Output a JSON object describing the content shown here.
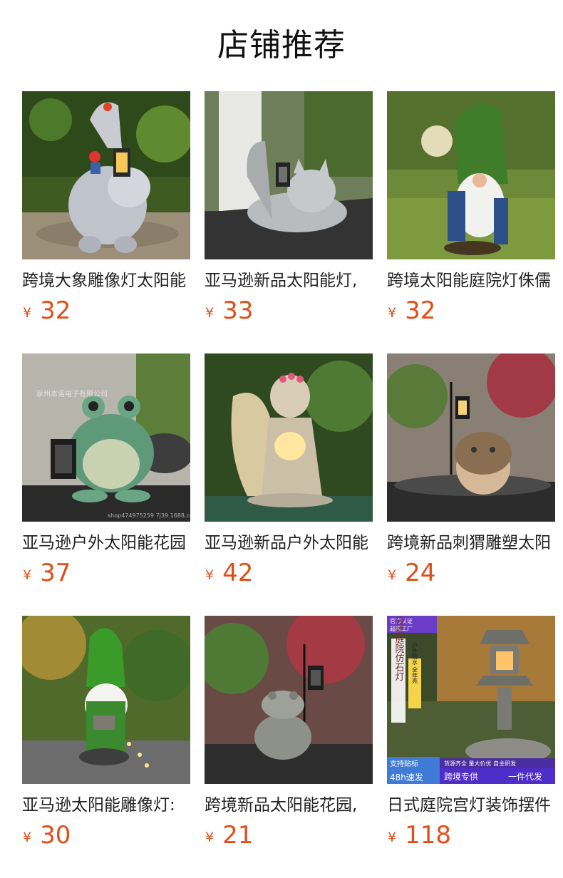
{
  "header": {
    "title": "店铺推荐"
  },
  "currency_symbol": "¥",
  "products": [
    {
      "name": "跨境大象雕像灯太阳能",
      "price": "32",
      "icon": "elephant-statue-lamp"
    },
    {
      "name": "亚马逊新品太阳能灯,",
      "price": "33",
      "icon": "cat-statue-lamp"
    },
    {
      "name": "跨境太阳能庭院灯侏儒",
      "price": "32",
      "icon": "gnome-statue-lamp"
    },
    {
      "name": "亚马逊户外太阳能花园",
      "price": "37",
      "icon": "frog-statue-lantern"
    },
    {
      "name": "亚马逊新品户外太阳能",
      "price": "42",
      "icon": "angel-statue-lamp"
    },
    {
      "name": "跨境新品刺猬雕塑太阳",
      "price": "24",
      "icon": "hedgehog-statue-lamp"
    },
    {
      "name": "亚马逊太阳能雕像灯:",
      "price": "30",
      "icon": "gnome-watering-lamp"
    },
    {
      "name": "跨境新品太阳能花园,",
      "price": "21",
      "icon": "frog-statue-lamp"
    },
    {
      "name": "日式庭院宫灯装饰摆件",
      "price": "118",
      "icon": "japanese-stone-lantern"
    }
  ],
  "image_text": {
    "watermark_shop": "shop474975259 7j39.1688.com",
    "watermark_company": "泉州本诺电子有限公司",
    "badge_official": "官方认证",
    "badge_factory": "超级工厂",
    "vertical_title": "日式庭院仿石灯",
    "vertical_features": "户外防水 全年亮",
    "vertical_power": "太阳能",
    "sticker_label": "支持贴标",
    "fast_ship": "48h速发",
    "bottom_tags": "货源齐全 量大价优 自主研发",
    "cross_border": "跨境专供",
    "dropship": "一件代发"
  }
}
